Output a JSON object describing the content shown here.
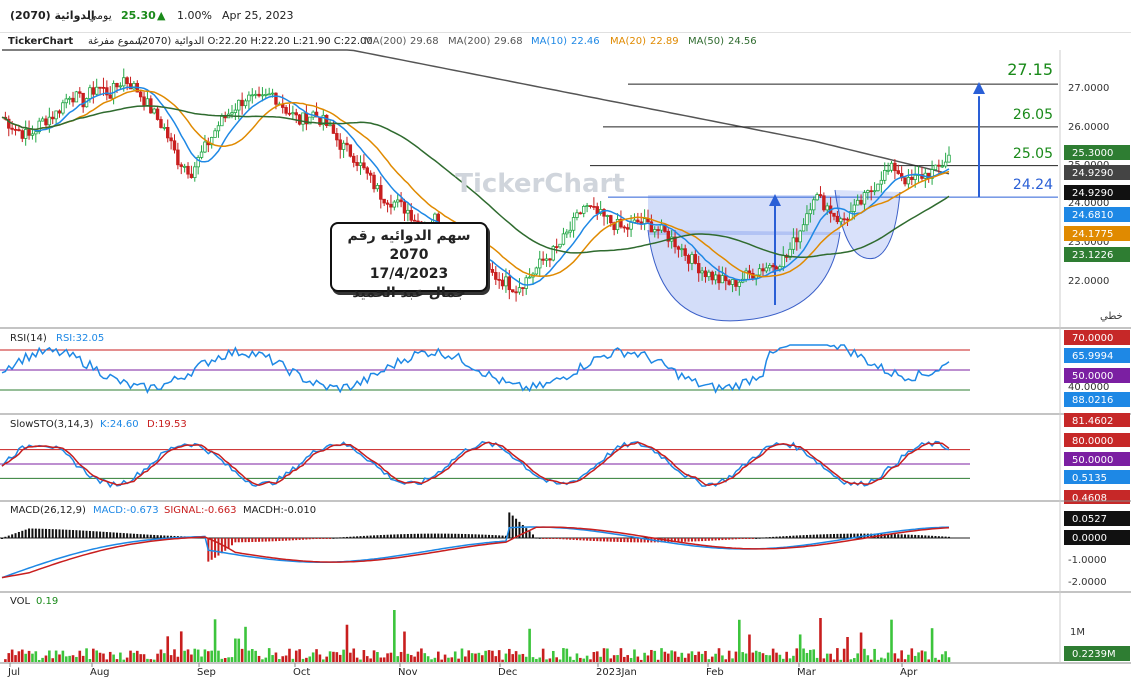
{
  "header": {
    "stock": "الدوائية (2070)",
    "period": "يومي",
    "price": "25.30",
    "change_pct": "1.00%",
    "date": "Apr 25, 2023"
  },
  "infobar": {
    "brand": "TickerChart",
    "chart_kind": "شموع مفرغة",
    "ohlc": "الدوائية (2070) O:22.20 H:22.20 L:21.90 C:22.00",
    "ma200_a_label": "MA(200)",
    "ma200_a_value": "29.68",
    "ma200_b_label": "MA(200)",
    "ma200_b_value": "29.68",
    "ma10_label": "MA(10)",
    "ma10_value": "22.46",
    "ma20_label": "MA(20)",
    "ma20_value": "22.89",
    "ma50_label": "MA(50)",
    "ma50_value": "24.56"
  },
  "watermark": "TickerChart",
  "annotation": {
    "line1": "سهم الدوائيه رقم 2070",
    "line2": "17/4/2023",
    "line3": "جمال عبد الحميد"
  },
  "levels": {
    "l1": "27.15",
    "l2": "26.05",
    "l3": "25.05",
    "l4": "24.24"
  },
  "price_axis": {
    "ticks": [
      "27.0000",
      "26.0000",
      "25.0000",
      "24.0000",
      "23.0000",
      "22.0000"
    ],
    "badges": [
      "25.3000",
      "24.9290",
      "24.9290",
      "24.6810",
      "24.1775",
      "23.1226"
    ],
    "scale_label": "خطي"
  },
  "rsi": {
    "title": "RSI(14)",
    "value_text": "RSI:32.05",
    "badges": [
      "70.0000",
      "65.9994",
      "50.0000",
      "88.0216"
    ],
    "tick": "40.0000"
  },
  "stoch": {
    "title": "SlowSTO(3,14,3)",
    "k_text": "K:24.60",
    "d_text": "D:19.53",
    "badges": [
      "81.4602",
      "80.0000",
      "50.0000",
      "0.5135",
      "0.4608"
    ]
  },
  "macd": {
    "title": "MACD(26,12,9)",
    "macd_text": "MACD:-0.673",
    "signal_text": "SIGNAL:-0.663",
    "hist_text": "MACDH:-0.010",
    "badges": [
      "0.0527",
      "0.0000"
    ],
    "ticks": [
      "-1.0000",
      "-2.0000"
    ]
  },
  "volume": {
    "title": "VOL",
    "value_text": "0.19",
    "tick": "1M",
    "badge": "0.2239M"
  },
  "x_axis": {
    "labels": [
      "Jul",
      "Aug",
      "Sep",
      "Oct",
      "Nov",
      "Dec",
      "2023Jan",
      "Feb",
      "Mar",
      "Apr"
    ]
  },
  "colors": {
    "up": "#22a745",
    "down": "#c81e1e",
    "ma10": "#1e88e5",
    "ma20": "#e08a00",
    "ma50": "#2f6b2f",
    "ma200": "#555555",
    "level_blue": "#2a5fd6",
    "green_text": "#1a8a1a",
    "badge_green": "#2e7d32",
    "badge_dark": "#111111",
    "badge_blue": "#1e88e5",
    "badge_red": "#c62828",
    "badge_purple": "#7b1fa2",
    "badge_orange": "#e08a00"
  },
  "chart_data": {
    "type": "candlestick",
    "title": "الدوائية (2070)",
    "x_labels": [
      "Jul",
      "Aug",
      "Sep",
      "Oct",
      "Nov",
      "Dec",
      "2023Jan",
      "Feb",
      "Mar",
      "Apr"
    ],
    "ylim": [
      21.0,
      28.0
    ],
    "close_path": [
      [
        0,
        26.3
      ],
      [
        4,
        26.0
      ],
      [
        8,
        25.8
      ],
      [
        12,
        26.2
      ],
      [
        16,
        26.4
      ],
      [
        20,
        26.9
      ],
      [
        24,
        26.7
      ],
      [
        28,
        27.1
      ],
      [
        32,
        26.9
      ],
      [
        36,
        27.3
      ],
      [
        40,
        27.0
      ],
      [
        44,
        26.5
      ],
      [
        48,
        26.0
      ],
      [
        52,
        25.2
      ],
      [
        56,
        24.9
      ],
      [
        60,
        25.5
      ],
      [
        64,
        26.1
      ],
      [
        68,
        26.5
      ],
      [
        72,
        26.8
      ],
      [
        76,
        26.7
      ],
      [
        80,
        26.9
      ],
      [
        84,
        26.5
      ],
      [
        88,
        26.2
      ],
      [
        92,
        26.4
      ],
      [
        96,
        26.1
      ],
      [
        100,
        25.6
      ],
      [
        104,
        25.3
      ],
      [
        108,
        24.8
      ],
      [
        112,
        24.3
      ],
      [
        116,
        24.1
      ],
      [
        120,
        23.9
      ],
      [
        124,
        23.5
      ],
      [
        128,
        23.7
      ],
      [
        132,
        23.2
      ],
      [
        136,
        22.9
      ],
      [
        140,
        22.6
      ],
      [
        144,
        22.3
      ],
      [
        148,
        22.1
      ],
      [
        152,
        21.9
      ],
      [
        156,
        22.2
      ],
      [
        160,
        22.6
      ],
      [
        164,
        22.9
      ],
      [
        168,
        23.4
      ],
      [
        172,
        24.0
      ],
      [
        176,
        23.8
      ],
      [
        180,
        23.6
      ],
      [
        184,
        23.4
      ],
      [
        188,
        23.6
      ],
      [
        192,
        23.5
      ],
      [
        196,
        23.3
      ],
      [
        200,
        23.0
      ],
      [
        204,
        22.6
      ],
      [
        208,
        22.3
      ],
      [
        212,
        22.1
      ],
      [
        216,
        22.0
      ],
      [
        220,
        22.2
      ],
      [
        224,
        22.4
      ],
      [
        228,
        22.5
      ],
      [
        232,
        22.7
      ],
      [
        236,
        23.4
      ],
      [
        240,
        24.3
      ],
      [
        244,
        24.0
      ],
      [
        248,
        23.6
      ],
      [
        252,
        23.9
      ],
      [
        256,
        24.3
      ],
      [
        260,
        24.8
      ],
      [
        264,
        25.0
      ],
      [
        268,
        24.6
      ],
      [
        272,
        24.8
      ],
      [
        276,
        24.9
      ],
      [
        280,
        25.3
      ]
    ],
    "moving_averages": [
      {
        "name": "MA(10)",
        "value": 22.46
      },
      {
        "name": "MA(20)",
        "value": 22.89
      },
      {
        "name": "MA(50)",
        "value": 24.56
      },
      {
        "name": "MA(200)",
        "value": 29.68
      }
    ],
    "levels": [
      27.15,
      26.05,
      25.05,
      24.24
    ],
    "last_close": 25.3,
    "change_pct": 1.0,
    "rsi": {
      "last": 65.9994,
      "bands": [
        70,
        50,
        40
      ]
    },
    "stoch": {
      "k": 24.6,
      "d": 19.53,
      "bands": [
        80,
        50,
        20
      ]
    },
    "macd": {
      "macd": -0.673,
      "signal": -0.663,
      "hist": -0.01
    },
    "volume_last_m": 0.2239
  }
}
